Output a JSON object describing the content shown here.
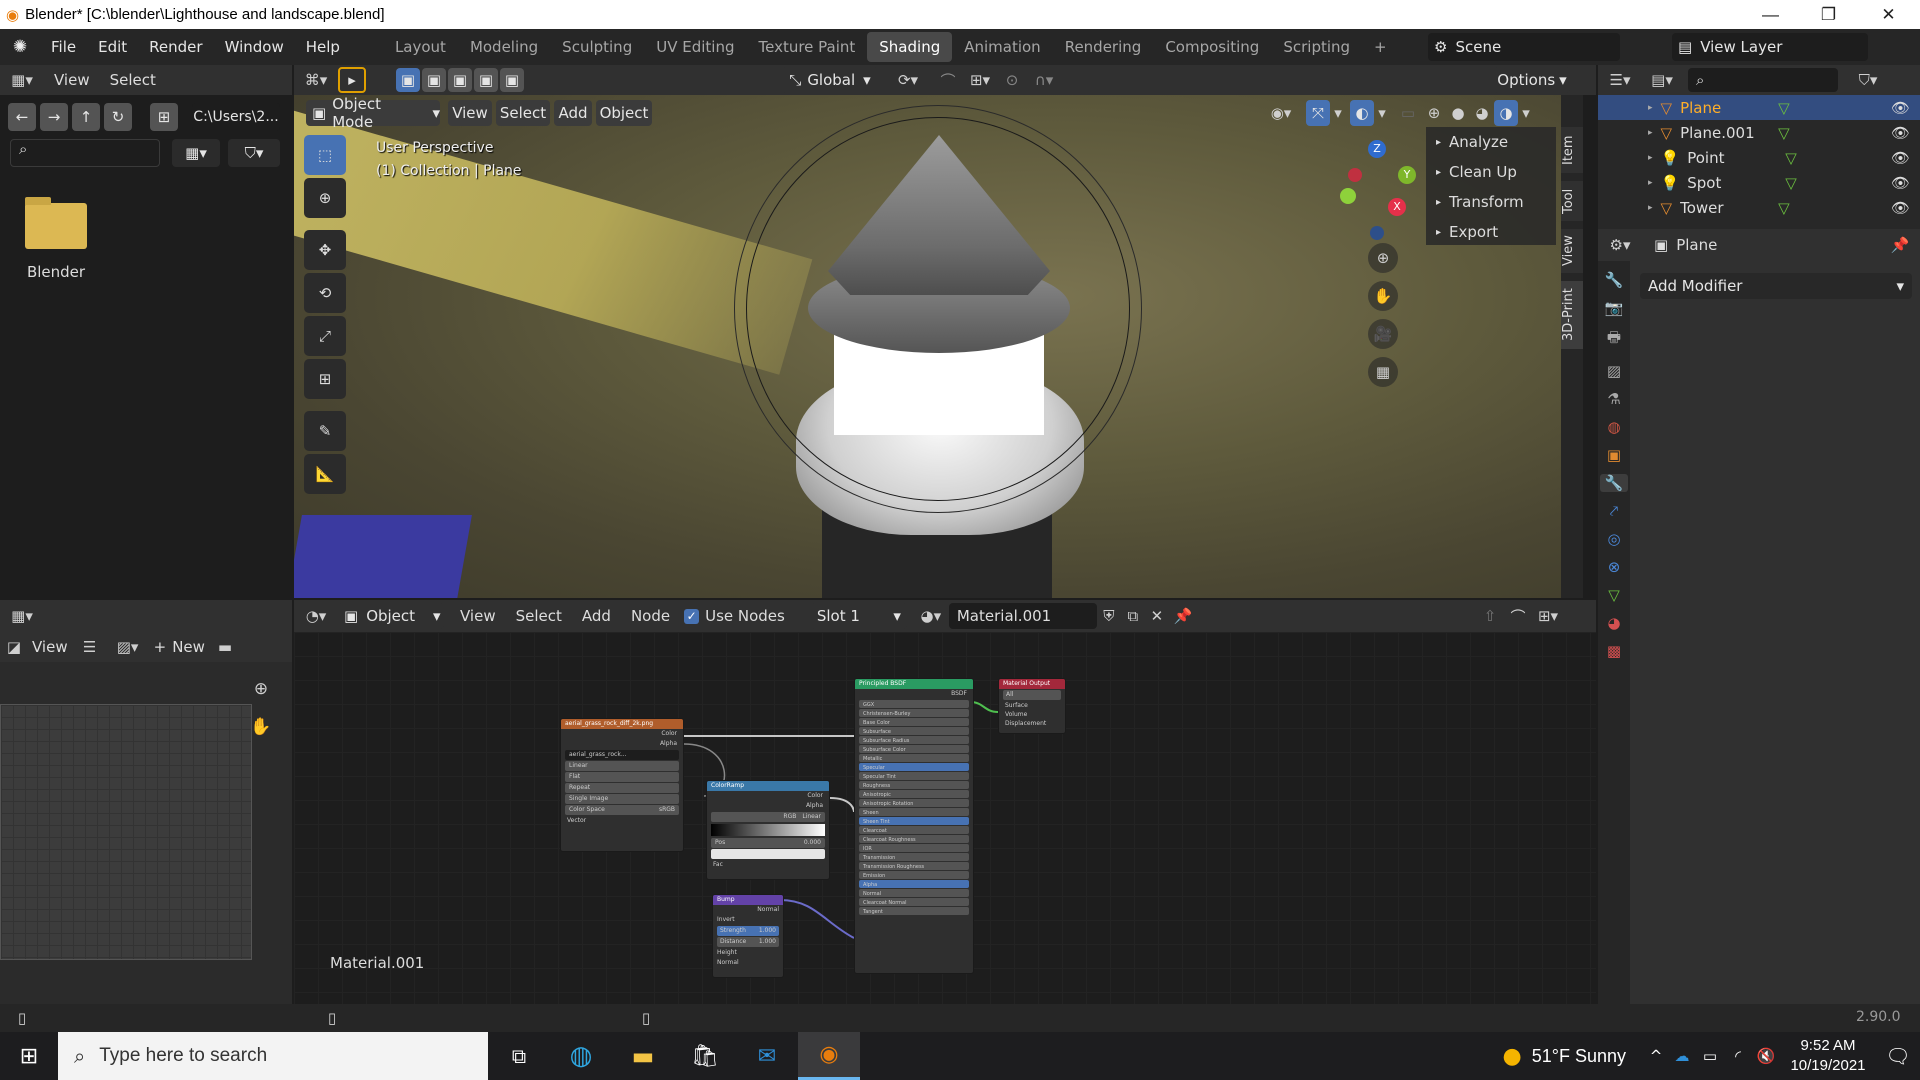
{
  "window": {
    "title": "Blender* [C:\\blender\\Lighthouse and landscape.blend]",
    "min": "—",
    "max": "❐",
    "close": "✕"
  },
  "menus": [
    "File",
    "Edit",
    "Render",
    "Window",
    "Help"
  ],
  "workspaces": [
    "Layout",
    "Modeling",
    "Sculpting",
    "UV Editing",
    "Texture Paint",
    "Shading",
    "Animation",
    "Rendering",
    "Compositing",
    "Scripting",
    "+"
  ],
  "active_workspace": "Shading",
  "scene": {
    "label": "Scene",
    "view_layer": "View Layer"
  },
  "file_browser": {
    "header": [
      "View",
      "Select"
    ],
    "path": "C:\\Users\\2...",
    "folder": "Blender"
  },
  "viewport": {
    "header": {
      "mode": "Object Mode",
      "menus": [
        "View",
        "Select",
        "Add",
        "Object"
      ],
      "orientation": "Global",
      "options": "Options"
    },
    "overlay_text": [
      "User Perspective",
      "(1) Collection | Plane"
    ],
    "npanel": [
      "Analyze",
      "Clean Up",
      "Transform",
      "Export"
    ],
    "side_tabs": [
      "Item",
      "Tool",
      "View",
      "3D-Print"
    ],
    "gizmo": {
      "x": "X",
      "y": "Y",
      "z": "Z"
    }
  },
  "node_editor": {
    "type": "Object",
    "menus": [
      "View",
      "Select",
      "Add",
      "Node"
    ],
    "use_nodes": "Use Nodes",
    "slot": "Slot 1",
    "material": "Material.001",
    "label": "Material.001",
    "nodes": {
      "image": {
        "title": "aerial_grass_rock_diff_2k.png",
        "outputs": [
          "Color",
          "Alpha"
        ],
        "fields": [
          "aerial_grass_rock...",
          "Linear",
          "Flat",
          "Repeat",
          "Single Image",
          "Color Space",
          "Vector"
        ],
        "colorspace": "sRGB"
      },
      "colorramp": {
        "title": "ColorRamp",
        "outputs": [
          "Color",
          "Alpha"
        ],
        "fields": [
          "RGB",
          "Linear",
          "Pos",
          "0.000",
          "Fac"
        ]
      },
      "bump": {
        "title": "Bump",
        "outputs": [
          "Normal"
        ],
        "fields": [
          "Invert",
          "Strength",
          "1.000",
          "Distance",
          "1.000",
          "Height",
          "Normal"
        ]
      },
      "bsdf": {
        "title": "Principled BSDF",
        "output": "BSDF",
        "fields": [
          "GGX",
          "Christensen-Burley",
          "Base Color",
          "Subsurface",
          "Subsurface Radius",
          "Subsurface Color",
          "Metallic",
          "Specular",
          "Specular Tint",
          "Roughness",
          "Anisotropic",
          "Anisotropic Rotation",
          "Sheen",
          "Sheen Tint",
          "Clearcoat",
          "Clearcoat Roughness",
          "IOR",
          "Transmission",
          "Transmission Roughness",
          "Emission",
          "Alpha",
          "Normal",
          "Clearcoat Normal",
          "Tangent"
        ],
        "ior": "1.450"
      },
      "output": {
        "title": "Material Output",
        "fields": [
          "All",
          "Surface",
          "Volume",
          "Displacement"
        ]
      }
    }
  },
  "image_editor": {
    "view": "View",
    "new": "New"
  },
  "outliner": {
    "items": [
      {
        "name": "Plane",
        "selected": true
      },
      {
        "name": "Plane.001",
        "selected": false
      },
      {
        "name": "Point",
        "selected": false
      },
      {
        "name": "Spot",
        "selected": false
      },
      {
        "name": "Tower",
        "selected": false
      }
    ]
  },
  "properties": {
    "object": "Plane",
    "add_modifier": "Add Modifier"
  },
  "status": {
    "version": "2.90.0"
  },
  "taskbar": {
    "search": "Type here to search",
    "weather": "51°F  Sunny",
    "time": "9:52 AM",
    "date": "10/19/2021"
  },
  "colors": {
    "accent": "#4772b3",
    "selection": "#334d80",
    "active_tab": "#494949"
  }
}
